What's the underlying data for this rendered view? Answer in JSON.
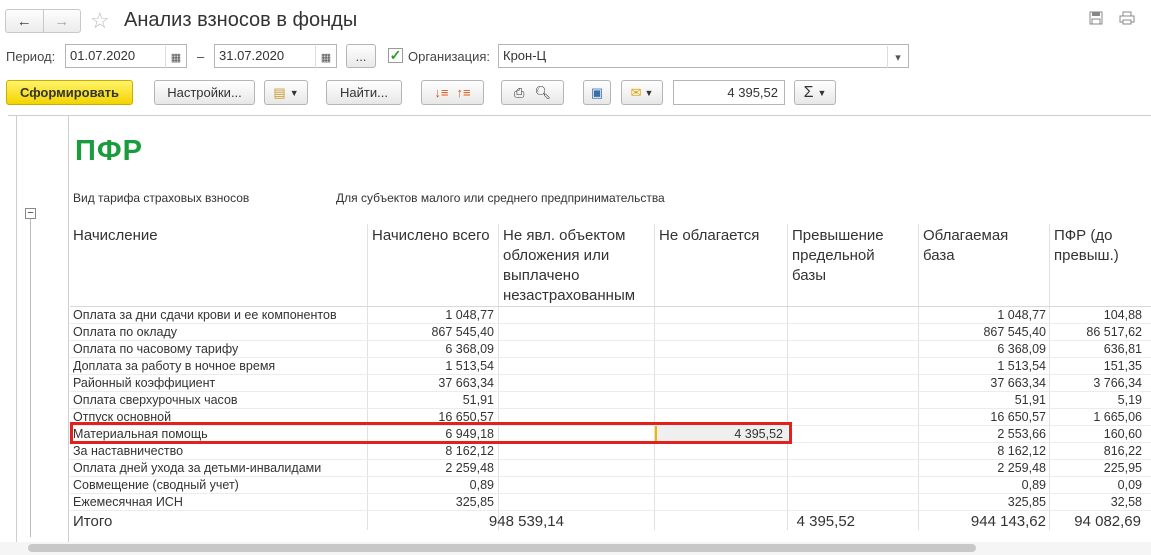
{
  "window": {
    "title": "Анализ взносов в фонды"
  },
  "params": {
    "period_label": "Период:",
    "date_from": "01.07.2020",
    "dash": "–",
    "date_to": "31.07.2020",
    "ellipsis": "...",
    "org_label": "Организация:",
    "org_value": "Крон-Ц",
    "org_checked": true
  },
  "toolbar": {
    "generate_label": "Сформировать",
    "settings_label": "Настройки...",
    "find_label": "Найти...",
    "sum_value": "4 395,52",
    "sigma": "Σ"
  },
  "report": {
    "section_title": "ПФР",
    "tariff_label": "Вид тарифа страховых взносов",
    "tariff_value": "Для субъектов малого или среднего предпринимательства",
    "headers": [
      "Начисление",
      "Начислено всего",
      "Не явл. объектом обложения или выплачено незастрахованным",
      "Не облагается",
      "Превышение предельной базы",
      "Облагаемая база",
      "ПФР (до превыш.)"
    ],
    "rows": [
      {
        "name": "Оплата за дни сдачи крови и ее компонентов",
        "total": "1 048,77",
        "nonobj": "",
        "exempt": "",
        "excess": "",
        "base": "1 048,77",
        "pfr": "104,88"
      },
      {
        "name": "Оплата по окладу",
        "total": "867 545,40",
        "nonobj": "",
        "exempt": "",
        "excess": "",
        "base": "867 545,40",
        "pfr": "86 517,62"
      },
      {
        "name": "Оплата по часовому тарифу",
        "total": "6 368,09",
        "nonobj": "",
        "exempt": "",
        "excess": "",
        "base": "6 368,09",
        "pfr": "636,81"
      },
      {
        "name": "Доплата за работу в ночное время",
        "total": "1 513,54",
        "nonobj": "",
        "exempt": "",
        "excess": "",
        "base": "1 513,54",
        "pfr": "151,35"
      },
      {
        "name": "Районный коэффициент",
        "total": "37 663,34",
        "nonobj": "",
        "exempt": "",
        "excess": "",
        "base": "37 663,34",
        "pfr": "3 766,34"
      },
      {
        "name": "Оплата сверхурочных часов",
        "total": "51,91",
        "nonobj": "",
        "exempt": "",
        "excess": "",
        "base": "51,91",
        "pfr": "5,19"
      },
      {
        "name": "Отпуск основной",
        "total": "16 650,57",
        "nonobj": "",
        "exempt": "",
        "excess": "",
        "base": "16 650,57",
        "pfr": "1 665,06"
      },
      {
        "name": "Материальная помощь",
        "total": "6 949,18",
        "nonobj": "",
        "exempt": "4 395,52",
        "excess": "",
        "base": "2 553,66",
        "pfr": "160,60"
      },
      {
        "name": "За наставничество",
        "total": "8 162,12",
        "nonobj": "",
        "exempt": "",
        "excess": "",
        "base": "8 162,12",
        "pfr": "816,22"
      },
      {
        "name": "Оплата дней ухода за детьми-инвалидами",
        "total": "2 259,48",
        "nonobj": "",
        "exempt": "",
        "excess": "",
        "base": "2 259,48",
        "pfr": "225,95"
      },
      {
        "name": "Совмещение (сводный учет)",
        "total": "0,89",
        "nonobj": "",
        "exempt": "",
        "excess": "",
        "base": "0,89",
        "pfr": "0,09"
      },
      {
        "name": "Ежемесячная ИСН",
        "total": "325,85",
        "nonobj": "",
        "exempt": "",
        "excess": "",
        "base": "325,85",
        "pfr": "32,58"
      }
    ],
    "totals": {
      "label": "Итого",
      "total": "948 539,14",
      "exempt": "4 395,52",
      "base": "944 143,62",
      "pfr": "94 082,69"
    }
  },
  "colors": {
    "section_title": "#1a9b3c",
    "highlight_border": "#e0211d",
    "primary_button": "#f3d400"
  }
}
